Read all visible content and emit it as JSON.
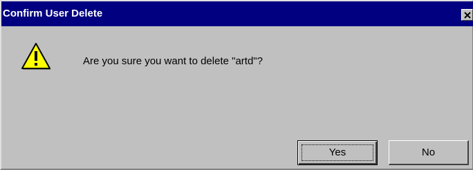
{
  "window": {
    "title": "Confirm User Delete"
  },
  "dialog": {
    "message": "Are you sure you want to delete \"artd\"?",
    "icon": "warning-icon"
  },
  "buttons": {
    "yes_label": "Yes",
    "no_label": "No"
  },
  "colors": {
    "titlebar": "#000080",
    "dialog_bg": "#c0c0c0",
    "icon_fill": "#ffff00"
  }
}
